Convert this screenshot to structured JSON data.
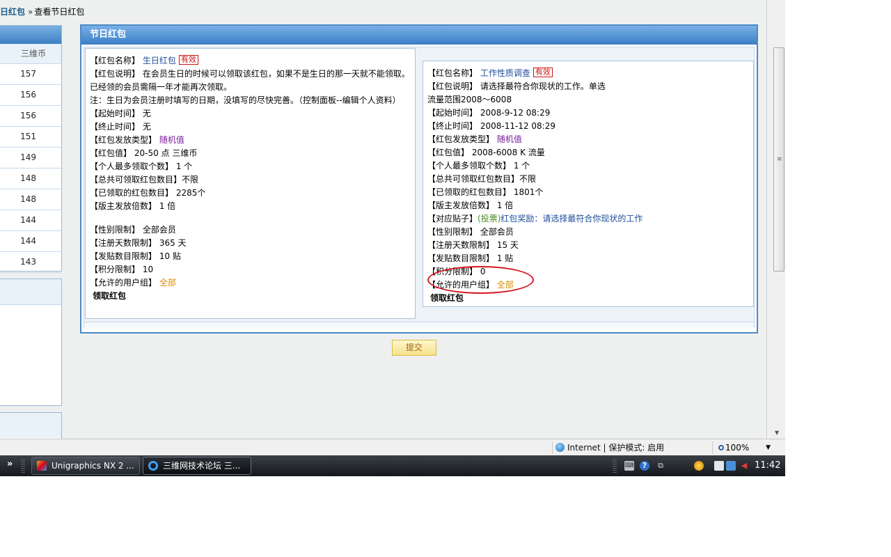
{
  "breadcrumb": {
    "parent": "日红包",
    "separator": "»",
    "current": "查看节日红包"
  },
  "rank_table": {
    "column_header": "三维币",
    "values": [
      "157",
      "156",
      "156",
      "151",
      "149",
      "148",
      "148",
      "144",
      "144",
      "143"
    ]
  },
  "panel": {
    "title": "节日红包"
  },
  "card1": {
    "name_label": "【红包名称】",
    "name_value": "生日红包",
    "badge": "有效",
    "desc_label": "【红包说明】",
    "desc_text": "在会员生日的时候可以领取该红包，如果不是生日的那一天就不能领取。已经领的会员需隔一年才能再次领取。",
    "note": "注：生日为会员注册时填写的日期，没填写的尽快完善。（控制面板--编辑个人资料）",
    "start_label": "【起始时间】",
    "start_value": "无",
    "end_label": "【终止时间】",
    "end_value": "无",
    "type_label": "【红包发放类型】",
    "type_value": "随机值",
    "value_label": "【红包值】",
    "value_value": "20-50 点  三维币",
    "per_user_label": "【个人最多领取个数】",
    "per_user_value": "1 个",
    "total_label": "【总共可领取红包数目】",
    "total_value": "不限",
    "claimed_label": "【已领取的红包数目】",
    "claimed_value": "2285个",
    "multiplier_label": "【版主发放倍数】",
    "multiplier_value": "1 倍",
    "gender_label": "【性别限制】",
    "gender_value": "全部会员",
    "regdays_label": "【注册天数限制】",
    "regdays_value": "365 天",
    "posts_label": "【发贴数目限制】",
    "posts_value": "10 贴",
    "points_label": "【积分限制】",
    "points_value": "10",
    "groups_label": "【允许的用户组】",
    "groups_value": "全部",
    "claim_label": "领取红包"
  },
  "card2": {
    "name_label": "【红包名称】",
    "name_value": "工作性质调查",
    "badge": "有效",
    "desc_label": "【红包说明】",
    "desc_text": "请选择最符合你现状的工作。单选",
    "desc_text2": "流量范围2008～6008",
    "start_label": "【起始时间】",
    "start_value": "2008-9-12 08:29",
    "end_label": "【终止时间】",
    "end_value": "2008-11-12 08:29",
    "type_label": "【红包发放类型】",
    "type_value": "随机值",
    "value_label": "【红包值】",
    "value_value": "2008-6008 K 流量",
    "per_user_label": "【个人最多领取个数】",
    "per_user_value": "1 个",
    "total_label": "【总共可领取红包数目】",
    "total_value": "不限",
    "claimed_label": "【已领取的红包数目】",
    "claimed_value": "1801个",
    "multiplier_label": "【版主发放倍数】",
    "multiplier_value": "1 倍",
    "post_label": "【对应贴子】",
    "post_prefix": "(投票)",
    "post_title": "红包奖励：请选择最符合你现状的工作",
    "gender_label": "【性别限制】",
    "gender_value": "全部会员",
    "regdays_label": "【注册天数限制】",
    "regdays_value": "15 天",
    "posts_label": "【发贴数目限制】",
    "posts_value": "1 贴",
    "points_label": "【积分限制】",
    "points_value": "0",
    "groups_label": "【允许的用户组】",
    "groups_value": "全部",
    "claim_label": "领取红包"
  },
  "submit_label": "提交",
  "statusbar": {
    "zone_text": "Internet | 保护模式: 启用",
    "zoom": "100%"
  },
  "taskbar": {
    "chevron": "»",
    "items": [
      {
        "label": "Unigraphics NX 2 ...",
        "active": false
      },
      {
        "label": "三维网技术论坛 三...",
        "active": true
      }
    ],
    "help_glyph": "?",
    "clock": "11:42"
  },
  "colors": {
    "accent": "#3b7dc6",
    "annotation": "#d4141c",
    "badge": "#cc1111",
    "group_value": "#d98a00"
  }
}
